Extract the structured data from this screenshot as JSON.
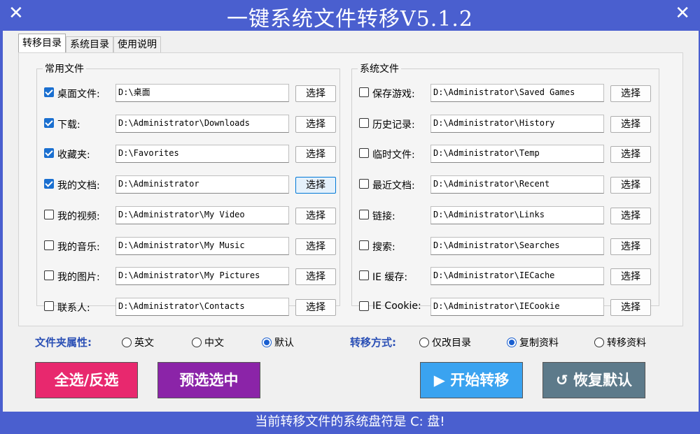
{
  "title": "一键系统文件转移V5.1.2",
  "close_glyph": "✕",
  "tabs": [
    "转移目录",
    "系统目录",
    "使用说明"
  ],
  "common_group": {
    "legend": "常用文件",
    "items": [
      {
        "label": "桌面文件:",
        "path": "D:\\桌面",
        "checked": true
      },
      {
        "label": "下载:",
        "path": "D:\\Administrator\\Downloads",
        "checked": true
      },
      {
        "label": "收藏夹:",
        "path": "D:\\Favorites",
        "checked": true
      },
      {
        "label": "我的文档:",
        "path": "D:\\Administrator",
        "checked": true
      },
      {
        "label": "我的视频:",
        "path": "D:\\Administrator\\My Video",
        "checked": false
      },
      {
        "label": "我的音乐:",
        "path": "D:\\Administrator\\My Music",
        "checked": false
      },
      {
        "label": "我的图片:",
        "path": "D:\\Administrator\\My Pictures",
        "checked": false
      },
      {
        "label": "联系人:",
        "path": "D:\\Administrator\\Contacts",
        "checked": false
      }
    ]
  },
  "system_group": {
    "legend": "系统文件",
    "items": [
      {
        "label": "保存游戏:",
        "path": "D:\\Administrator\\Saved Games",
        "checked": false
      },
      {
        "label": "历史记录:",
        "path": "D:\\Administrator\\History",
        "checked": false
      },
      {
        "label": "临时文件:",
        "path": "D:\\Administrator\\Temp",
        "checked": false
      },
      {
        "label": "最近文档:",
        "path": "D:\\Administrator\\Recent",
        "checked": false
      },
      {
        "label": "链接:",
        "path": "D:\\Administrator\\Links",
        "checked": false
      },
      {
        "label": "搜索:",
        "path": "D:\\Administrator\\Searches",
        "checked": false
      },
      {
        "label": "IE 缓存:",
        "path": "D:\\Administrator\\IECache",
        "checked": false
      },
      {
        "label": "IE Cookie:",
        "path": "D:\\Administrator\\IECookie",
        "checked": false
      }
    ]
  },
  "select_button_label": "选择",
  "folder_attr": {
    "label": "文件夹属性:",
    "options": [
      "英文",
      "中文",
      "默认"
    ],
    "selected": "默认"
  },
  "transfer_mode": {
    "label": "转移方式:",
    "options": [
      "仅改目录",
      "复制资料",
      "转移资料"
    ],
    "selected": "复制资料"
  },
  "buttons": {
    "select_all": "全选/反选",
    "preselect": "预选选中",
    "start": "▶ 开始转移",
    "restore": "↺ 恢复默认"
  },
  "colors": {
    "title_bg": "#4a5fcf",
    "select_all": "#e8286e",
    "preselect": "#8b24a8",
    "start": "#3aa3f0",
    "restore": "#5d7a8a"
  },
  "status": "当前转移文件的系统盘符是 C: 盘!"
}
